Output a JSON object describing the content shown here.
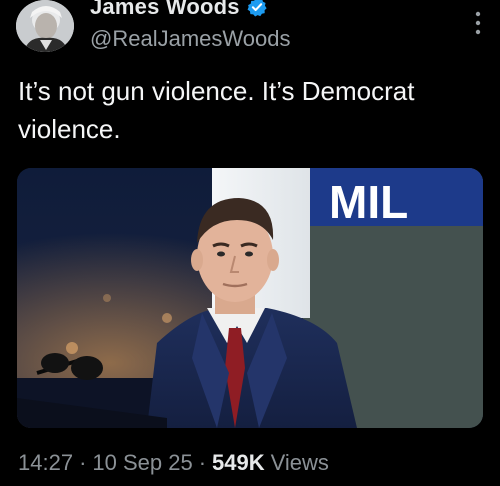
{
  "author": {
    "display_name": "James Woods",
    "handle": "@RealJamesWoods",
    "verified": true,
    "verified_color": "#1d9bf0"
  },
  "tweet": {
    "text": "It’s not gun violence. It’s Democrat violence."
  },
  "media": {
    "banner_text": "MIL"
  },
  "meta": {
    "time": "14:27",
    "separator": "·",
    "date": "10 Sep 25",
    "views_count": "549K",
    "views_label": "Views"
  },
  "icons": {
    "more": "more-vertical-icon",
    "verified": "verified-badge-icon"
  }
}
